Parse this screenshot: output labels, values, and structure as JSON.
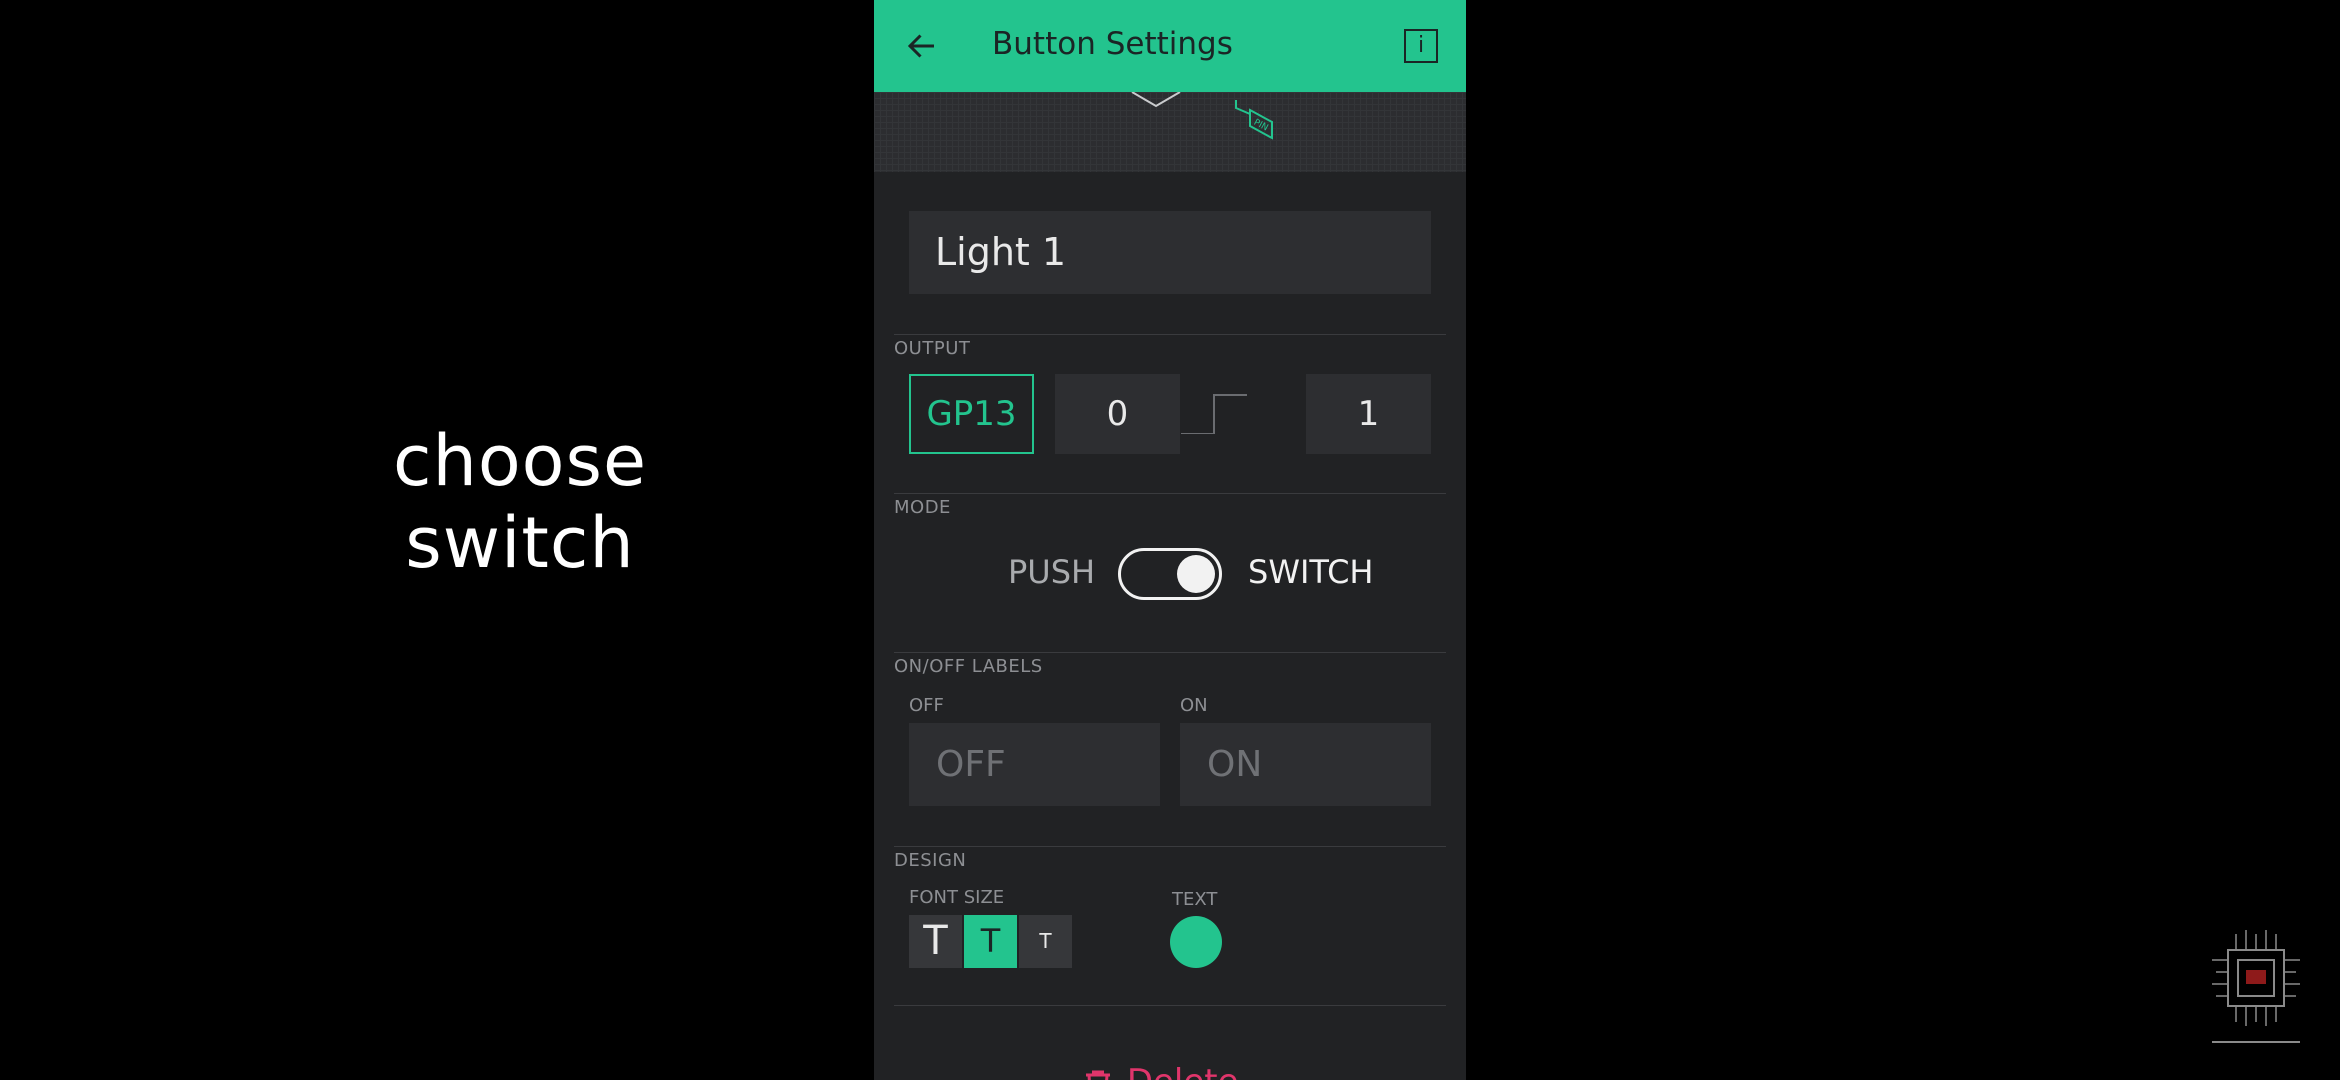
{
  "overlay": {
    "caption": "choose switch"
  },
  "appbar": {
    "title": "Button Settings",
    "info_glyph": "i",
    "back_icon": "arrow-left-icon",
    "info_icon": "info-icon"
  },
  "hero": {
    "pin_badge": "PIN"
  },
  "name_field": {
    "value": "Light 1"
  },
  "output": {
    "section_label": "OUTPUT",
    "pin": "GP13",
    "low_value": "0",
    "high_value": "1"
  },
  "mode": {
    "section_label": "MODE",
    "push_label": "PUSH",
    "switch_label": "SWITCH",
    "selected": "SWITCH"
  },
  "labels": {
    "section_label": "ON/OFF LABELS",
    "off_label": "OFF",
    "on_label": "ON",
    "off_placeholder": "OFF",
    "on_placeholder": "ON"
  },
  "design": {
    "section_label": "DESIGN",
    "font_size_label": "FONT SIZE",
    "text_label": "TEXT",
    "font_sizes": [
      "T",
      "T",
      "T"
    ],
    "selected_font_index": 1,
    "text_color": "#23c48e"
  },
  "footer": {
    "delete_label": "Delete",
    "delete_icon": "trash-icon"
  },
  "colors": {
    "accent": "#23c48e",
    "background": "#212224",
    "field": "#2d2e31",
    "danger": "#e0356b"
  }
}
